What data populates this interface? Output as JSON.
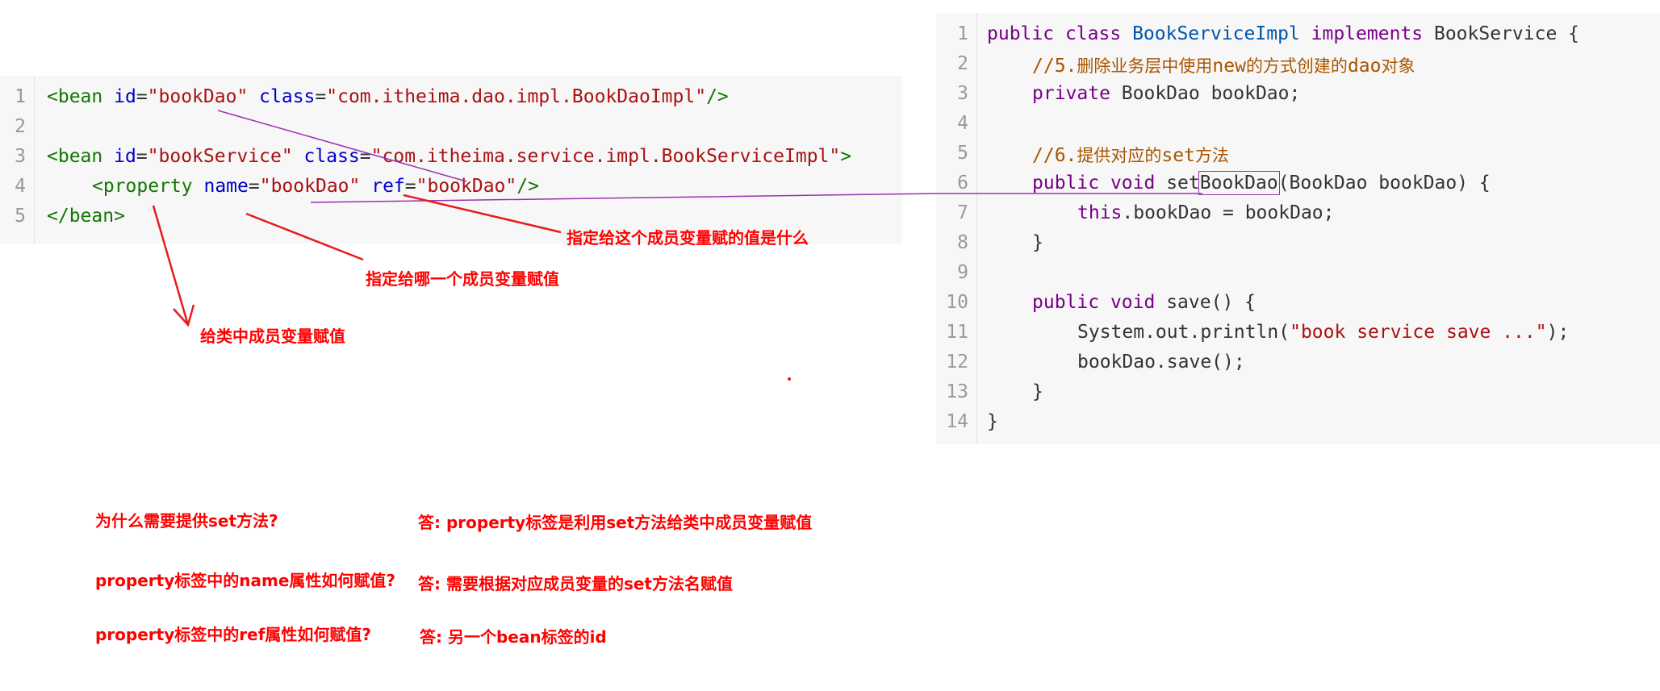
{
  "xml": {
    "line_numbers": [
      "1",
      "2",
      "3",
      "4",
      "5"
    ],
    "line1": {
      "open": "<bean",
      "id_attr": "id",
      "eq": "=",
      "id_val": "\"bookDao\"",
      "class_attr": "class",
      "class_val": "\"com.itheima.dao.impl.BookDaoImpl\"",
      "close": "/>"
    },
    "line3": {
      "open": "<bean",
      "id_attr": "id",
      "eq": "=",
      "id_val": "\"bookService\"",
      "class_attr": "class",
      "class_val": "\"com.itheima.service.impl.BookServiceImpl\"",
      "close": ">"
    },
    "line4": {
      "open": "<property",
      "name_attr": "name",
      "eq": "=",
      "name_val": "\"bookDao\"",
      "ref_attr": "ref",
      "ref_val": "\"bookDao\"",
      "close": "/>"
    },
    "line5": {
      "close": "</bean>"
    }
  },
  "java": {
    "line_numbers": [
      "1",
      "2",
      "3",
      "4",
      "5",
      "6",
      "7",
      "8",
      "9",
      "10",
      "11",
      "12",
      "13",
      "14"
    ],
    "l1": {
      "public": "public",
      "class": "class",
      "name": "BookServiceImpl",
      "implements": "implements",
      "iface": "BookService {"
    },
    "l2": {
      "comment_a": "//5.",
      "comment_b": "删除业务层中使用",
      "comment_c": "new",
      "comment_d": "的方式创建的",
      "comment_e": "dao",
      "comment_f": "对象"
    },
    "l3": {
      "private": "private",
      "rest": "BookDao bookDao;"
    },
    "l5": {
      "comment_a": "//6.",
      "comment_b": "提供对应的",
      "comment_c": "set",
      "comment_d": "方法"
    },
    "l6": {
      "public": "public",
      "void": "void",
      "set": "set",
      "boxed": "BookDao",
      "rest": "(BookDao bookDao) {"
    },
    "l7": {
      "this": "this",
      "rest": ".bookDao = bookDao;"
    },
    "l8": {
      "brace": "}"
    },
    "l10": {
      "public": "public",
      "void": "void",
      "rest": "save() {"
    },
    "l11": {
      "pre": "System.out.println(",
      "str": "\"book service save ...\"",
      "post": ");"
    },
    "l12": {
      "code": "bookDao.save();"
    },
    "l13": {
      "brace": "}"
    },
    "l14": {
      "brace": "}"
    }
  },
  "annotations": {
    "value_note": "指定给这个成员变量赋的值是什么",
    "which_member_note": "指定给哪一个成员变量赋值",
    "assign_note": "给类中成员变量赋值"
  },
  "qa": [
    {
      "q": "为什么需要提供set方法?",
      "a": "答: property标签是利用set方法给类中成员变量赋值"
    },
    {
      "q": "property标签中的name属性如何赋值?",
      "a": "答: 需要根据对应成员变量的set方法名赋值"
    },
    {
      "q": "property标签中的ref属性如何赋值?",
      "a": "答: 另一个bean标签的id"
    }
  ],
  "colors": {
    "annotation": "#ff0000",
    "connector": "#9b30b0",
    "tag": "#117700",
    "attribute": "#0000cc",
    "string": "#aa1111",
    "keyword": "#770088",
    "class_name": "#0055aa",
    "comment": "#aa5500"
  }
}
